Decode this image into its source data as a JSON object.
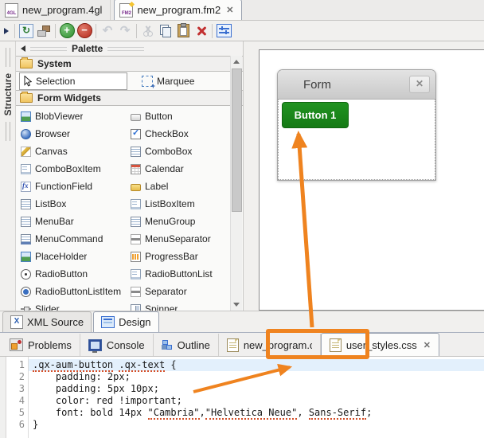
{
  "editor_tabs": [
    {
      "label": "new_program.4gl",
      "icon": "4gl-file-icon",
      "icon_text": "4GL",
      "active": false
    },
    {
      "label": "new_program.fm2",
      "icon": "fm2-file-icon",
      "icon_text": "FM2",
      "active": true,
      "close_glyph": "✕"
    }
  ],
  "toolbar": {
    "icons": [
      "collapse-arrow",
      "refresh",
      "layout-resize",
      "add",
      "remove",
      "undo",
      "redo",
      "cut",
      "copy",
      "paste",
      "delete",
      "form-settings"
    ],
    "refresh_glyph": "↻",
    "add_glyph": "+",
    "remove_glyph": "−",
    "undo_glyph": "↶",
    "redo_glyph": "↷"
  },
  "structure_panel": {
    "label": "Structure"
  },
  "palette": {
    "title": "Palette",
    "sections": [
      {
        "label": "System",
        "items": [
          {
            "label": "Selection",
            "icon": "cursor",
            "selected": true
          },
          {
            "label": "Marquee",
            "icon": "marquee",
            "selected": false
          }
        ]
      },
      {
        "label": "Form Widgets",
        "items": [
          {
            "label": "BlobViewer",
            "icon": "image"
          },
          {
            "label": "Button",
            "icon": "button"
          },
          {
            "label": "Browser",
            "icon": "globe"
          },
          {
            "label": "CheckBox",
            "icon": "checkbox"
          },
          {
            "label": "Canvas",
            "icon": "pencil"
          },
          {
            "label": "ComboBox",
            "icon": "combo"
          },
          {
            "label": "ComboBoxItem",
            "icon": "comboitem"
          },
          {
            "label": "Calendar",
            "icon": "calendar"
          },
          {
            "label": "FunctionField",
            "icon": "fx"
          },
          {
            "label": "Label",
            "icon": "label"
          },
          {
            "label": "ListBox",
            "icon": "lines"
          },
          {
            "label": "ListBoxItem",
            "icon": "comboitem"
          },
          {
            "label": "MenuBar",
            "icon": "lines"
          },
          {
            "label": "MenuGroup",
            "icon": "lines"
          },
          {
            "label": "MenuCommand",
            "icon": "menucmd"
          },
          {
            "label": "MenuSeparator",
            "icon": "separator"
          },
          {
            "label": "PlaceHolder",
            "icon": "image"
          },
          {
            "label": "ProgressBar",
            "icon": "progress"
          },
          {
            "label": "RadioButton",
            "icon": "radio"
          },
          {
            "label": "RadioButtonList",
            "icon": "comboitem"
          },
          {
            "label": "RadioButtonListItem",
            "icon": "radiofilled"
          },
          {
            "label": "Separator",
            "icon": "separator"
          },
          {
            "label": "Slider",
            "icon": "slider"
          },
          {
            "label": "Spinner",
            "icon": "spinner"
          }
        ]
      }
    ]
  },
  "design": {
    "form_title": "Form",
    "form_close_glyph": "✕",
    "button_label": "Button 1",
    "button_color": "#1b8a1b"
  },
  "view_tabs": [
    {
      "label": "XML Source",
      "active": false
    },
    {
      "label": "Design",
      "active": true
    }
  ],
  "bottom_tabs": [
    {
      "label": "Problems",
      "icon": "problems-icon"
    },
    {
      "label": "Console",
      "icon": "console-icon"
    },
    {
      "label": "Outline",
      "icon": "outline-icon"
    },
    {
      "label": "new_program.css",
      "icon": "css-file-icon",
      "truncated": true
    },
    {
      "label": "user_styles.css",
      "icon": "css-file-icon",
      "active": true,
      "close_glyph": "✕"
    }
  ],
  "code": {
    "lines": [
      {
        "n": "1",
        "highlight": true,
        "segments": [
          {
            "t": ".qx-aum-button",
            "squiggle": true
          },
          {
            "t": " "
          },
          {
            "t": ".qx-text",
            "squiggle": true
          },
          {
            "t": " {"
          }
        ]
      },
      {
        "n": "2",
        "segments": [
          {
            "t": "    padding: 2px;"
          }
        ]
      },
      {
        "n": "3",
        "segments": [
          {
            "t": "    padding: 5px 10px;"
          }
        ]
      },
      {
        "n": "4",
        "segments": [
          {
            "t": "    color: red !important;"
          }
        ]
      },
      {
        "n": "5",
        "segments": [
          {
            "t": "    font: bold 14px "
          },
          {
            "t": "\"Cambria\"",
            "squiggle": true
          },
          {
            "t": ","
          },
          {
            "t": "\"Helvetica Neue\"",
            "squiggle": true
          },
          {
            "t": ", "
          },
          {
            "t": "Sans-Serif",
            "squiggle": true
          },
          {
            "t": ";"
          }
        ]
      },
      {
        "n": "6",
        "segments": [
          {
            "t": "}"
          }
        ]
      }
    ]
  },
  "annotations": {
    "color": "#ef831f",
    "highlight_rect_target": "user_styles.css tab",
    "arrow_1_target": "Button 1",
    "arrow_2_target": "user_styles.css tab"
  }
}
